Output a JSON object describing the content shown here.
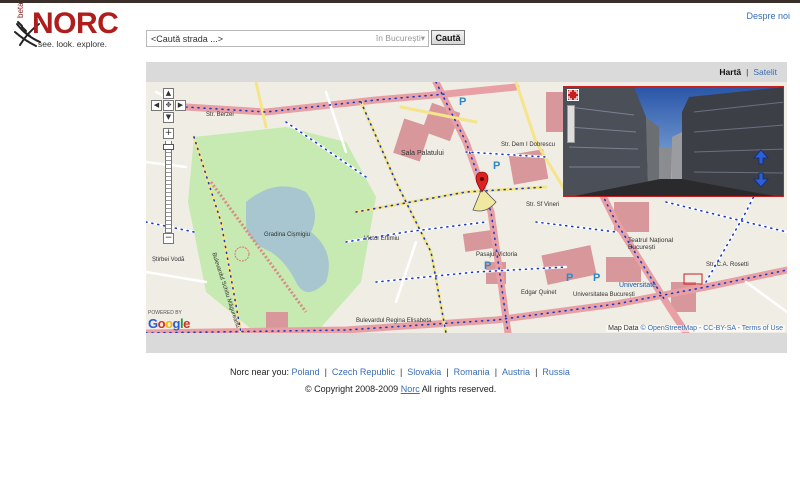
{
  "logo": {
    "wordmark": "NORC",
    "tagline": "see. look. explore.",
    "badge": "beta"
  },
  "header": {
    "about_link": "Despre noi"
  },
  "search": {
    "value": "<Caută strada ...>",
    "city": "în București",
    "city_arrow": "▾",
    "button_label": "Caută"
  },
  "map_types": {
    "active": "Hartă",
    "other": "Satelit",
    "separator": "|"
  },
  "map": {
    "labels": {
      "str_berzei": "Str. Berzei",
      "sala_palatului": "Sala Palatului",
      "str_dem_dobrescu": "Str. Dem I Dobrescu",
      "gradina_cismigiu": "Gradina Cișmigiu",
      "victor_eftimiu": "Victor Eftimiu",
      "pasajul_victoria": "Pasajul Victoria",
      "teatrul_national": "Teatrul Național București",
      "universitate_metro": "Universitate",
      "universitatea": "Universitatea București",
      "bd_regina_elisabeta": "Bulevardul Regina Elisabeta",
      "bd_schitu_magureanu": "Bulevardul Schitu Măgureanu",
      "str_sf_vineri": "Str. Sf Vineri",
      "edgar_quinet": "Edgar Quinet",
      "stirbei_voda": "Știrbei Vodă",
      "c_a_rosetti": "Str. C.A. Rosetti"
    },
    "parking_symbol": "P",
    "powered_by": "POWERED BY",
    "google_letters": [
      "G",
      "o",
      "o",
      "g",
      "l",
      "e"
    ],
    "attribution_prefix": "Map Data",
    "attribution_osm": "© OpenStreetMap - CC-BY-SA",
    "attribution_suffix": "- Terms of Use"
  },
  "footer": {
    "near_prefix": "Norc near you:",
    "countries": [
      "Poland",
      "Czech Republic",
      "Slovakia",
      "Romania",
      "Austria",
      "Russia"
    ],
    "separator": "|",
    "copyright_prefix": "© Copyright 2008-2009",
    "copyright_link": "Norc",
    "copyright_suffix": "All rights reserved."
  },
  "colors": {
    "brand": "#b01d1d",
    "link": "#3a6db5",
    "map_bg": "#f0ede5",
    "park": "#c6eab1",
    "water": "#a8c6cf",
    "major_road": "#e8a0a5",
    "building": "#d8989b",
    "street_view_border": "#c81e1e",
    "coverage_dots": "#1a3cc8"
  },
  "icons": {
    "logo_tracks": "crossed-tracks-icon",
    "pan_up": "arrow-up-icon",
    "pan_down": "arrow-down-icon",
    "pan_left": "arrow-left-icon",
    "pan_right": "arrow-right-icon",
    "pan_center": "center-icon",
    "zoom_in": "plus-icon",
    "zoom_out": "minus-icon",
    "location_pin": "map-pin-icon",
    "view_cone": "view-cone-icon",
    "sv_expand": "expand-icon",
    "sv_forward": "blue-up-arrow-icon",
    "sv_back": "blue-down-arrow-icon"
  }
}
